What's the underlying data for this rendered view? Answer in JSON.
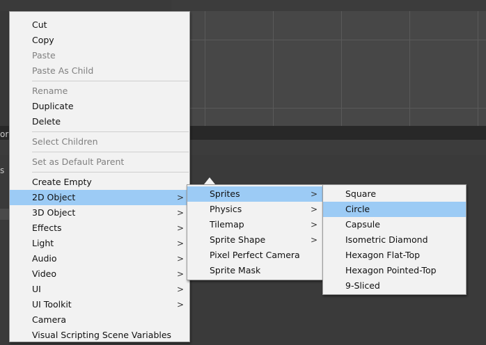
{
  "background": {
    "left_edge_texts": [
      "or",
      "s"
    ]
  },
  "menu_main": {
    "items": [
      {
        "label": "Cut",
        "disabled": false
      },
      {
        "label": "Copy",
        "disabled": false
      },
      {
        "label": "Paste",
        "disabled": true
      },
      {
        "label": "Paste As Child",
        "disabled": true
      },
      {
        "label": "Rename",
        "disabled": true
      },
      {
        "label": "Duplicate",
        "disabled": false
      },
      {
        "label": "Delete",
        "disabled": false
      },
      {
        "label": "Select Children",
        "disabled": true
      },
      {
        "label": "Set as Default Parent",
        "disabled": true
      },
      {
        "label": "Create Empty",
        "disabled": false
      },
      {
        "label": "2D Object",
        "submenu": true,
        "highlighted": true
      },
      {
        "label": "3D Object",
        "submenu": true
      },
      {
        "label": "Effects",
        "submenu": true
      },
      {
        "label": "Light",
        "submenu": true
      },
      {
        "label": "Audio",
        "submenu": true
      },
      {
        "label": "Video",
        "submenu": true
      },
      {
        "label": "UI",
        "submenu": true
      },
      {
        "label": "UI Toolkit",
        "submenu": true
      },
      {
        "label": "Camera"
      },
      {
        "label": "Visual Scripting Scene Variables"
      }
    ]
  },
  "menu_2d": {
    "items": [
      {
        "label": "Sprites",
        "submenu": true,
        "highlighted": true
      },
      {
        "label": "Physics",
        "submenu": true
      },
      {
        "label": "Tilemap",
        "submenu": true
      },
      {
        "label": "Sprite Shape",
        "submenu": true
      },
      {
        "label": "Pixel Perfect Camera"
      },
      {
        "label": "Sprite Mask"
      }
    ]
  },
  "menu_sprites": {
    "items": [
      {
        "label": "Square"
      },
      {
        "label": "Circle",
        "highlighted": true
      },
      {
        "label": "Capsule"
      },
      {
        "label": "Isometric Diamond"
      },
      {
        "label": "Hexagon Flat-Top"
      },
      {
        "label": "Hexagon Pointed-Top"
      },
      {
        "label": "9-Sliced"
      }
    ]
  },
  "icons": {
    "submenu_arrow": ">"
  },
  "colors": {
    "menu_bg": "#f2f2f2",
    "highlight": "#9ccbf5",
    "disabled_text": "#808080"
  }
}
